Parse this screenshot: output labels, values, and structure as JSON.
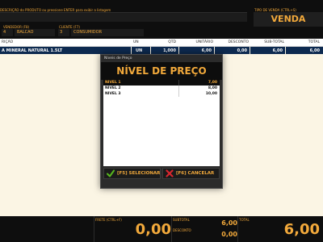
{
  "header": {
    "description_label": "DESCRIÇÃO do PRODUTO ou pressione ENTER para exibir a listagem",
    "sale_type_label": "TIPO DE VENDA (CTRL+S)",
    "sale_type_value": "VENDA",
    "seller_label": "VENDEDOR (F8)",
    "seller_code": "4",
    "seller_name": "BALCAO",
    "client_label": "CLIENTE (F7)",
    "client_code": "3",
    "client_name": "CONSUMIDOR"
  },
  "table": {
    "columns": [
      "RIÇÃO",
      "UN",
      "QTD",
      "UNITÁRIO",
      "DESCONTO",
      "SUB-TOTAL",
      "TOTAL"
    ],
    "rows": [
      {
        "description": "A MINERAL NATURAL 1.5LT",
        "un": "UN",
        "qtd": "1,000",
        "unitario": "6,00",
        "desconto": "0,00",
        "subtotal": "6,00",
        "total": "6,00"
      }
    ]
  },
  "footer": {
    "frete_label": "FRETE (CTRL+F)",
    "frete_value": "0,00",
    "subtotal_label": "SUBTOTAL",
    "subtotal_value": "6,00",
    "desconto_label": "DESCONTO",
    "desconto_value": "0,00",
    "total_label": "TOTAL",
    "total_value": "6,00"
  },
  "modal": {
    "window_title": "Níveis de Preço",
    "heading": "NÍVEL DE PREÇO",
    "levels": [
      {
        "name": "NIVEL 1",
        "value": "7,00",
        "selected": true
      },
      {
        "name": "NIVEL 2",
        "value": "8,00",
        "selected": false
      },
      {
        "name": "NIVEL 3",
        "value": "10,00",
        "selected": false
      }
    ],
    "select_button": "[F5] SELECIONAR",
    "cancel_button": "[F6] CANCELAR",
    "select_icon": "check-icon",
    "cancel_icon": "x-icon",
    "colors": {
      "accent": "#f2a93b",
      "check": "#58b81e",
      "cancel": "#d8262e",
      "selected_row_bg": "#0d0d0d"
    }
  }
}
